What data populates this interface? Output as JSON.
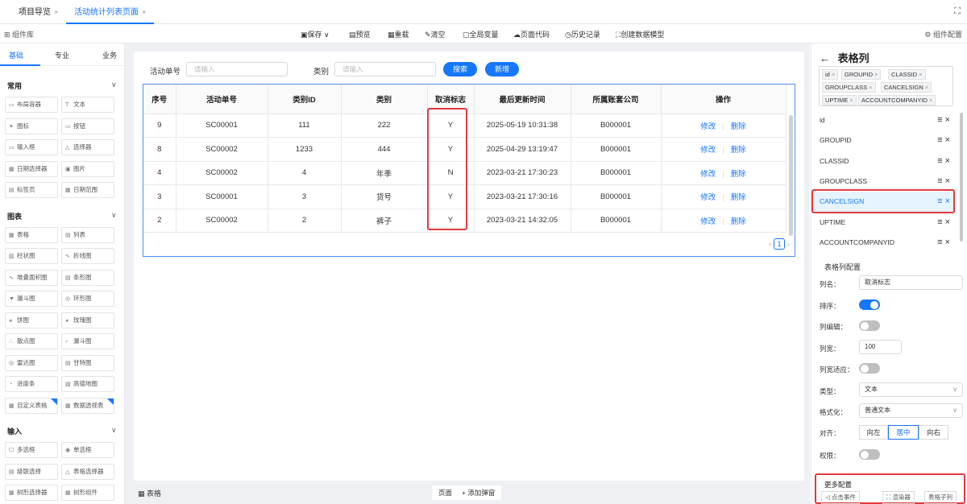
{
  "tabs": [
    {
      "label": "项目导览",
      "close": "×"
    },
    {
      "label": "活动统计列表页面",
      "close": "×"
    }
  ],
  "toolbar": {
    "library": "组件库",
    "save": "保存",
    "preview": "预览",
    "reload": "重载",
    "clear": "清空",
    "global_vars": "全局变量",
    "page_code": "页面代码",
    "history": "历史记录",
    "create_model": "创建数据模型",
    "component_config": "组件配置"
  },
  "left": {
    "tabs": [
      "基础",
      "专业",
      "业务"
    ],
    "sections": [
      {
        "title": "常用",
        "items": [
          [
            "布局容器",
            "文本"
          ],
          [
            "图标",
            "按钮"
          ],
          [
            "输入框",
            "选择器"
          ],
          [
            "日期选择器",
            "图片"
          ],
          [
            "标签页",
            "日期范围"
          ]
        ]
      },
      {
        "title": "图表",
        "items": [
          [
            "表格",
            "列表"
          ],
          [
            "柱状图",
            "折线图"
          ],
          [
            "堆叠面积图",
            "条形图"
          ],
          [
            "漏斗图",
            "环形图"
          ],
          [
            "饼图",
            "玫瑰图"
          ],
          [
            "散点图",
            "漏斗图"
          ],
          [
            "雷达图",
            "甘特图"
          ],
          [
            "进度条",
            "高德地图"
          ],
          [
            "自定义表格",
            "数据透视表"
          ]
        ]
      },
      {
        "title": "输入",
        "items": [
          [
            "多选框",
            "单选框"
          ],
          [
            "级联选择",
            "表格选择器"
          ],
          [
            "树形选择器",
            "树形组件"
          ]
        ]
      }
    ]
  },
  "search": {
    "order_label": "活动单号",
    "order_placeholder": "请输入",
    "type_label": "类别",
    "type_placeholder": "请输入",
    "search_btn": "搜索",
    "add_btn": "新增"
  },
  "table": {
    "headers": [
      "序号",
      "活动单号",
      "类别ID",
      "类别",
      "取消标志",
      "最后更新时间",
      "所属账套公司",
      "操作"
    ],
    "rows": [
      [
        "9",
        "SC00001",
        "111",
        "222",
        "Y",
        "2025-05-19 10:31:38",
        "B000001"
      ],
      [
        "8",
        "SC00002",
        "1233",
        "444",
        "Y",
        "2025-04-29 13:19:47",
        "B000001"
      ],
      [
        "4",
        "SC00002",
        "4",
        "年季",
        "N",
        "2023-03-21 17:30:23",
        "B000001"
      ],
      [
        "3",
        "SC00001",
        "3",
        "货号",
        "Y",
        "2023-03-21 17:30:16",
        "B000001"
      ],
      [
        "2",
        "SC00002",
        "2",
        "裤子",
        "Y",
        "2023-03-21 14:32:05",
        "B000001"
      ]
    ],
    "edit": "修改",
    "delete": "删除",
    "page": "1"
  },
  "bottom": {
    "label": "表格",
    "page_tab": "页面",
    "add_popup": "+ 添加弹窗"
  },
  "right": {
    "title": "表格列",
    "chips": [
      "id",
      "GROUPID",
      "CLASSID",
      "GROUPCLASS",
      "CANCELSIGN",
      "UPTIME",
      "ACCOUNTCOMPANYID"
    ],
    "columns": [
      "id",
      "GROUPID",
      "CLASSID",
      "GROUPCLASS",
      "CANCELSIGN",
      "UPTIME",
      "ACCOUNTCOMPANYID"
    ],
    "config_title": "表格列配置",
    "name_label": "列名：",
    "name_value": "取消标志",
    "sort_label": "排序：",
    "edit_label": "列编辑：",
    "width_label": "列宽：",
    "width_value": "100",
    "adapt_label": "列宽适应：",
    "type_label": "类型：",
    "type_value": "文本",
    "format_label": "格式化：",
    "format_value": "普通文本",
    "align_label": "对齐：",
    "align_options": [
      "向左",
      "居中",
      "向右"
    ],
    "perm_label": "权限：",
    "more_title": "更多配置",
    "more_buttons": [
      "点击事件",
      "渲染器",
      "表格子列"
    ]
  },
  "colors": {
    "accent": "#1677ff",
    "highlight": "#e4393c"
  }
}
